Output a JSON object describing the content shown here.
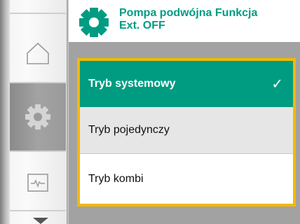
{
  "header": {
    "title_line1": "Pompa podwójna Funkcja",
    "title_line2": "Ext. OFF",
    "icon": "gear-icon"
  },
  "nav": {
    "items": [
      {
        "icon": "home-icon",
        "selected": false
      },
      {
        "icon": "settings-gear-icon",
        "selected": true
      },
      {
        "icon": "diagnostics-monitor-icon",
        "selected": false
      }
    ],
    "more_indicator": "chevron-down-icon"
  },
  "menu": {
    "options": [
      {
        "label": "Tryb systemowy",
        "selected": true,
        "checkmark": "✓"
      },
      {
        "label": "Tryb pojedynczy",
        "selected": false
      },
      {
        "label": "Tryb kombi",
        "selected": false
      }
    ]
  },
  "colors": {
    "accent": "#009c82",
    "focus_border": "#f5b800",
    "content_bg": "#a2a2a2"
  }
}
